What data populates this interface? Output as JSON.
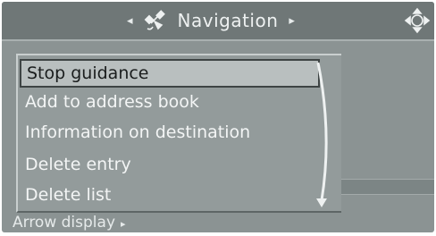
{
  "header": {
    "title": "Navigation",
    "left_arrow": "◂",
    "right_arrow": "▸",
    "left_icon": "satellite-icon",
    "right_icon": "controller-icon"
  },
  "menu": {
    "items": [
      {
        "label": "Stop guidance",
        "selected": true
      },
      {
        "label": "Add to address book",
        "selected": false
      },
      {
        "label": "Information on destination",
        "selected": false
      },
      {
        "label": "Delete entry",
        "selected": false
      },
      {
        "label": "Delete list",
        "selected": false
      }
    ]
  },
  "footer": {
    "label": "Arrow display",
    "arrow": "▸"
  },
  "colors": {
    "screen_bg": "#8b9393",
    "header_bg": "#6f7777",
    "menu_bg": "#939b9b",
    "selected_bg": "#b9bfbf",
    "text_light": "#f3f5f5",
    "text_dark": "#1a1d1d"
  }
}
